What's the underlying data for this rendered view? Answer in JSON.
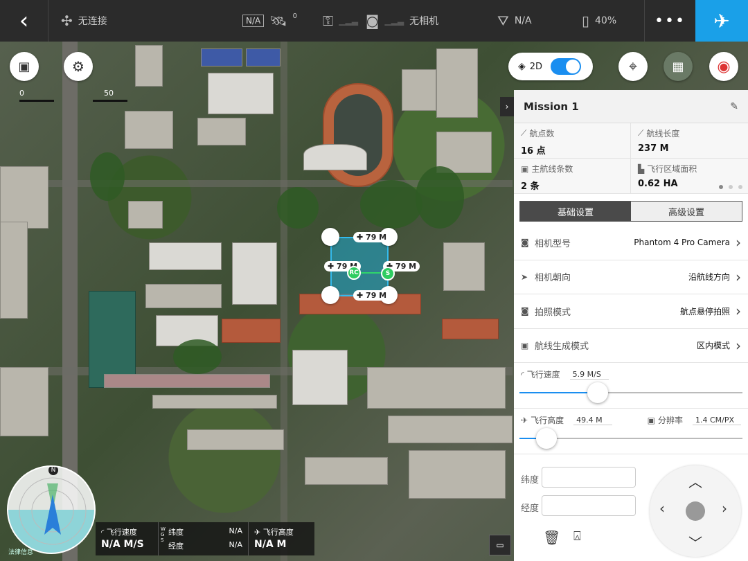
{
  "topbar": {
    "connection": "无连接",
    "rtk_na": "N/A",
    "gps_count": "0",
    "camera_status": "无相机",
    "altitude_label": "N/A",
    "battery": "40%"
  },
  "map": {
    "scale_zero": "0",
    "scale_max": "50",
    "toggle_label": "2D",
    "toggle_on": true,
    "legal_text": "法律信息",
    "polygon": {
      "edge_top": "79 M",
      "edge_left": "79 M",
      "edge_right": "79 M",
      "edge_bottom": "79 M",
      "rc_label": "RC",
      "start_label": "S"
    }
  },
  "panel": {
    "title": "Mission 1",
    "stats": [
      {
        "label": "航点数",
        "value": "16 点",
        "icon": "waypoint-icon"
      },
      {
        "label": "航线长度",
        "value": "237 M",
        "icon": "ruler-icon"
      },
      {
        "label": "主航线条数",
        "value": "2 条",
        "icon": "route-icon"
      },
      {
        "label": "飞行区域面积",
        "value": "0.62 HA",
        "icon": "area-icon"
      }
    ],
    "tabs": {
      "basic": "基础设置",
      "advanced": "高级设置"
    },
    "rows": [
      {
        "label": "相机型号",
        "value": "Phantom 4 Pro Camera",
        "icon": "camera-icon"
      },
      {
        "label": "相机朝向",
        "value": "沿航线方向",
        "icon": "direction-icon"
      },
      {
        "label": "拍照模式",
        "value": "航点悬停拍照",
        "icon": "photo-mode-icon"
      },
      {
        "label": "航线生成模式",
        "value": "区内模式",
        "icon": "route-gen-icon"
      }
    ],
    "speed": {
      "label": "飞行速度",
      "value": "5.9 M/S",
      "fraction": 0.35
    },
    "altitude": {
      "label": "飞行高度",
      "value": "49.4 M",
      "fraction": 0.12,
      "res_label": "分辨率",
      "res_value": "1.4 CM/PX"
    },
    "coords": {
      "lat_label": "纬度",
      "lng_label": "经度"
    }
  },
  "telemetry": {
    "speed_label": "飞行速度",
    "speed_value": "N/A M/S",
    "wgs": "WGS",
    "lat_label": "纬度",
    "lat_value": "N/A",
    "lng_label": "经度",
    "lng_value": "N/A",
    "alt_label": "飞行高度",
    "alt_value": "N/A M"
  },
  "compass": {
    "north": "N"
  }
}
